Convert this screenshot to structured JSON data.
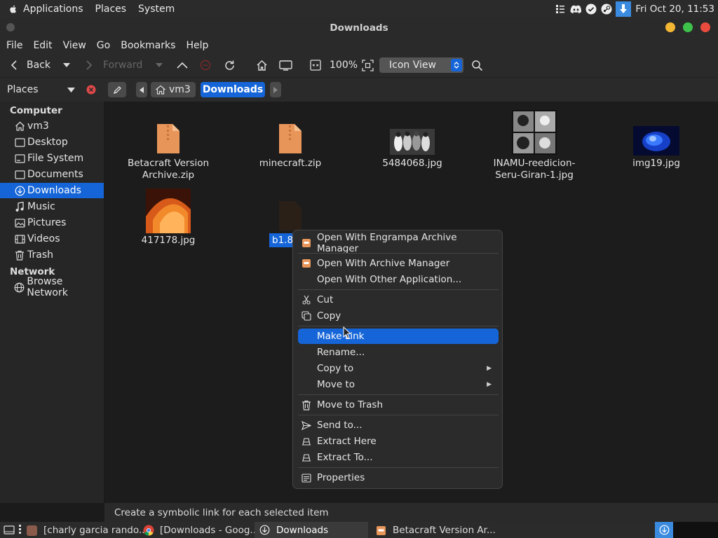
{
  "top_panel": {
    "menus": [
      "Applications",
      "Places",
      "System"
    ],
    "clock": "Fri Oct 20, 11:53"
  },
  "window": {
    "title": "Downloads"
  },
  "menubar": [
    "File",
    "Edit",
    "View",
    "Go",
    "Bookmarks",
    "Help"
  ],
  "toolbar": {
    "back": "Back",
    "forward": "Forward",
    "zoom": "100%",
    "view_mode": "Icon View"
  },
  "location": {
    "places_label": "Places",
    "crumbs": [
      "vm3",
      "Downloads"
    ]
  },
  "sidebar": {
    "computer_heading": "Computer",
    "network_heading": "Network",
    "items": [
      "vm3",
      "Desktop",
      "File System",
      "Documents",
      "Downloads",
      "Music",
      "Pictures",
      "Videos",
      "Trash"
    ],
    "network_items": [
      "Browse Network"
    ]
  },
  "files": [
    {
      "line1": "Betacraft Version",
      "line2": "Archive.zip"
    },
    {
      "line1": "minecraft.zip",
      "line2": ""
    },
    {
      "line1": "5484068.jpg",
      "line2": ""
    },
    {
      "line1": "INAMU-reedicion-",
      "line2": "Seru-Giran-1.jpg"
    },
    {
      "line1": "img19.jpg",
      "line2": ""
    },
    {
      "line1": "417178.jpg",
      "line2": ""
    },
    {
      "line1": "b1.8.",
      "line2": ""
    }
  ],
  "context_menu": {
    "items": [
      "Open With Engrampa Archive Manager",
      "Open With Archive Manager",
      "Open With Other Application...",
      "Cut",
      "Copy",
      "Make Link",
      "Rename...",
      "Copy to",
      "Move to",
      "Move to Trash",
      "Send to...",
      "Extract Here",
      "Extract To...",
      "Properties"
    ],
    "highlighted": "Make Link"
  },
  "status": "Create a symbolic link for each selected item",
  "taskbar": {
    "tasks": [
      "[charly garcia rando...",
      "[Downloads - Goog...",
      "Downloads",
      "Betacraft Version Ar..."
    ]
  },
  "colors": {
    "accent": "#1565d8",
    "bg": "#1c1c1c",
    "panel": "#2a2a2a"
  }
}
